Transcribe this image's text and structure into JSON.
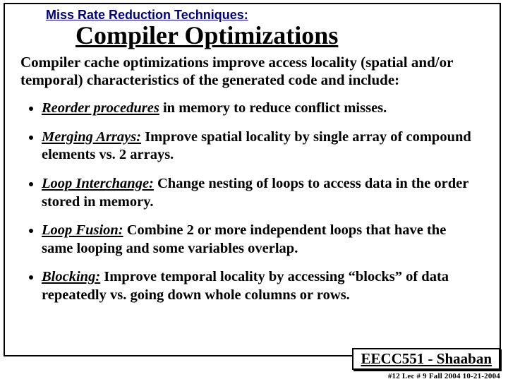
{
  "header": {
    "topic": "Miss Rate Reduction Techniques:",
    "title": "Compiler Optimizations"
  },
  "intro": "Compiler cache optimizations improve access locality (spatial and/or temporal) characteristics of the generated code and include:",
  "bullets": [
    {
      "key": "Reorder procedures",
      "text": " in memory to reduce conflict misses."
    },
    {
      "key": "Merging Arrays:",
      "text": "  Improve spatial locality by single array of compound elements vs. 2 arrays."
    },
    {
      "key": "Loop Interchange:",
      "text": "  Change nesting of loops to access data in the order stored in memory."
    },
    {
      "key": "Loop Fusion:",
      "text": "  Combine 2 or more independent loops that have the same looping and some variables overlap."
    },
    {
      "key": "Blocking:",
      "text": "  Improve temporal locality by accessing “blocks” of data repeatedly vs. going down whole columns or rows."
    }
  ],
  "footer": {
    "course": "EECC551 - Shaaban",
    "meta": "#12   Lec # 9  Fall 2004    10-21-2004"
  }
}
